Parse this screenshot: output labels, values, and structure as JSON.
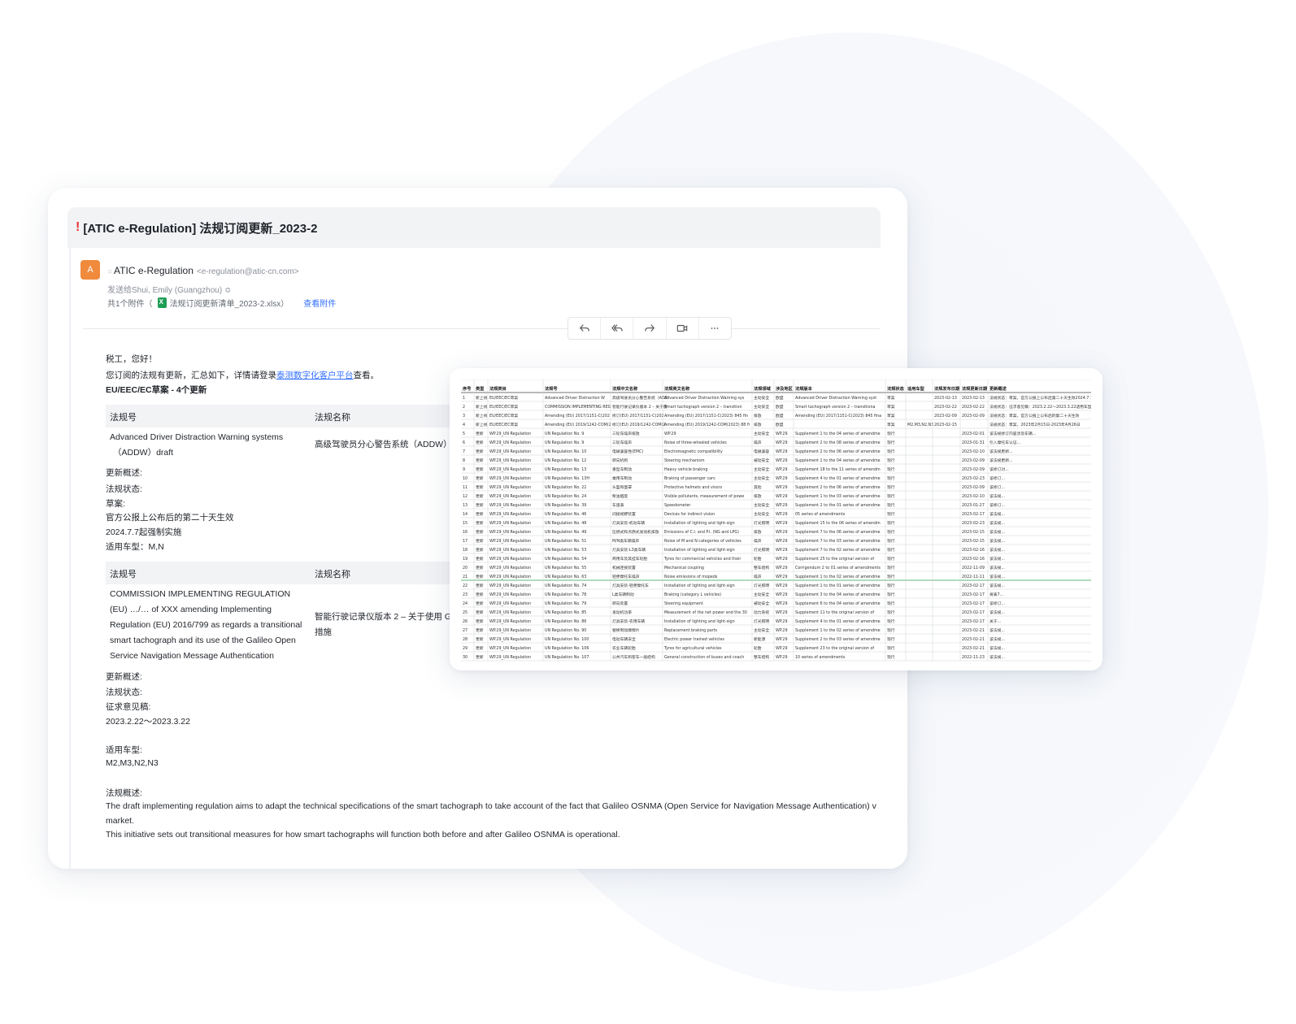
{
  "email": {
    "subject_mark": "!",
    "subject": "[ATIC e-Regulation] 法规订阅更新_2023-2",
    "avatar_letter": "A",
    "sender_name": "ATIC e-Regulation",
    "sender_email": "<e-regulation@atic-cn.com>",
    "to_line": "发送给Shui, Emily (Guangzhou) ≎",
    "attachment_count": "共1个附件（",
    "attachment_name": "法规订阅更新清单_2023-2.xlsx）",
    "view_attachment": "查看附件",
    "actions": [
      {
        "icon": "reply-icon"
      },
      {
        "icon": "reply-all-icon"
      },
      {
        "icon": "forward-icon"
      },
      {
        "icon": "video-icon"
      },
      {
        "icon": "more-icon"
      }
    ]
  },
  "body": {
    "greeting": "税工，您好！",
    "intro_prefix": "您订阅的法规有更新，汇总如下，详情请登录",
    "intro_link": "泰测数字化客户平台",
    "intro_suffix": "查看。",
    "section_title": "EU/EEC/EC草案 - 4个更新",
    "col_no": "法规号",
    "col_name": "法规名称",
    "item1": {
      "number_line1": "Advanced Driver Distraction Warning systems",
      "number_line2": "（ADDW）draft",
      "name": "高级驾驶员分心警告系统（ADDW）",
      "summary_label": "更新概述:",
      "status_label": "法规状态:",
      "status_value": "草案:",
      "line1": "官方公报上公布后的第二十天生效",
      "line2": "2024.7.7起强制实施",
      "vehicle": "适用车型：M,N"
    },
    "item2": {
      "number_lines": [
        "COMMISSION IMPLEMENTING REGULATION",
        "(EU) …/… of XXX amending Implementing",
        "Regulation (EU) 2016/799 as regards a transitional",
        "smart tachograph and its use of the Galileo Open",
        "Service Navigation Message Authentication"
      ],
      "name_line1": "智能行驶记录仪版本 2 – 关于使用 G",
      "name_line2": "措施",
      "summary_label": "更新概述:",
      "status_label": "法规状态:",
      "status_value": "征求意见稿:",
      "period": "2023.2.22～2023.3.22",
      "vehicle_label": "适用车型:",
      "vehicle_value": "M2,M3,N2,N3",
      "overview_label": "法规概述:",
      "overview_line1": "The draft implementing regulation aims to adapt the technical specifications of the smart tachograph to take account of the fact that Galileo OSNMA (Open Service for Navigation Message Authentication) v",
      "overview_line2": "market.",
      "overview_line3": "This initiative sets out transitional measures for how smart tachographs will function both before and after Galileo OSNMA is operational."
    }
  },
  "spreadsheet": {
    "headers": [
      "序号",
      "类型",
      "法规类目",
      "法规号",
      "法规中文名称",
      "法规英文名称",
      "法规领域",
      "涉及地区",
      "法规版本",
      "法规状态",
      "适用车型",
      "法规发布日期",
      "法规更新日期",
      "更新概述"
    ],
    "rows": [
      [
        "1",
        "新上线",
        "EU/EEC/EC草案",
        "Advanced Driver Distraction Warning",
        "高级驾驶员分心警告系统（ADD",
        "Advanced Driver Distraction Warning systems（A",
        "主动安全",
        "欧盟",
        "Advanced Driver Distraction Warning systems（ADD",
        "草案",
        "",
        "2023-02-13",
        "2023-02-13",
        "法规状态：草案，官方公报上公布后第二十天生效2024.7.7"
      ],
      [
        "2",
        "新上线",
        "EU/EEC/EC草案",
        "COMMISSION IMPLEMENTING REG",
        "智能行驶记录仪版本 2 – 关于使",
        "Smart tachograph version 2 – transitional measu",
        "主动安全",
        "欧盟",
        "Smart tachograph version 2 – transitional measu",
        "草案",
        "",
        "2023-02-22",
        "2023-02-22",
        "法规状态：征求意见稿：2023.2.22～2023.3.22适用车型：M"
      ],
      [
        "3",
        "新上线",
        "EU/EEC/EC草案",
        "Amending (EU) 2017/1151-C(2023)",
        "修订(EU) 2017/1151-C(2023)",
        "Amending (EU) 2017/1151-C(2023) 845 final",
        "排放",
        "欧盟",
        "Amending (EU) 2017/1151-C(2023) 845 final",
        "草案",
        "",
        "2023-02-09",
        "2023-02-09",
        "法规状态：草案，官方公报上公布后的第二十天生效"
      ],
      [
        "4",
        "新上线",
        "EU/EEC/EC草案",
        "Amending (EU) 2019/1242-COM(2",
        "修订(EU) 2019/1242-COM(2",
        "Amending (EU) 2019/1242-COM(2023) 88 final",
        "排放",
        "欧盟",
        "",
        "草案",
        "M2,M3,N2,N3",
        "2023-02-15",
        "",
        "法规状态：草案，2023年2月15日-2023年4月26日"
      ],
      [
        "5",
        "更新",
        "WP.29_UN Regulation",
        "UN Regulation No. 9",
        "三轮车噪声排放",
        "WP.29",
        "主动安全",
        "WP.29",
        "Supplement 1 to the 04 series of amendments",
        "现行",
        "",
        "",
        "2023-02-01",
        "该法规修订内容涉及车辆..."
      ],
      [
        "6",
        "更新",
        "WP.29_UN Regulation",
        "UN Regulation No. 9",
        "三轮车噪声",
        "Noise of three-wheeled vehicles",
        "噪声",
        "WP.29",
        "Supplement 2 to the 08 series of amendments",
        "现行",
        "",
        "",
        "2023-01-31",
        "引入摩托车认证..."
      ],
      [
        "7",
        "更新",
        "WP.29_UN Regulation",
        "UN Regulation No. 10",
        "电磁兼容性(EMC)",
        "Electromagnetic compatibility",
        "电磁兼容",
        "WP.29",
        "Supplement 2 to the 06 series of amendments",
        "现行",
        "",
        "",
        "2023-02-10",
        "该法规更新..."
      ],
      [
        "8",
        "更新",
        "WP.29_UN Regulation",
        "UN Regulation No. 12",
        "转向机构",
        "Steering mechanism",
        "被动安全",
        "WP.29",
        "Supplement 1 to the 04 series of amendments",
        "现行",
        "",
        "",
        "2023-02-09",
        "该法规更新..."
      ],
      [
        "9",
        "更新",
        "WP.29_UN Regulation",
        "UN Regulation No. 13",
        "重型车制动",
        "Heavy vehicle braking",
        "主动安全",
        "WP.29",
        "Supplement 18 to the 11 series of amendments",
        "现行",
        "",
        "",
        "2023-02-09",
        "该修订对..."
      ],
      [
        "10",
        "更新",
        "WP.29_UN Regulation",
        "UN Regulation No. 13H",
        "乘用车制动",
        "Braking of passenger cars",
        "主动安全",
        "WP.29",
        "Supplement 4 to the 01 series of amendments",
        "现行",
        "",
        "",
        "2023-02-23",
        "该修订..."
      ],
      [
        "11",
        "更新",
        "WP.29_UN Regulation",
        "UN Regulation No. 22",
        "头盔和面罩",
        "Protective helmets and visors",
        "其他",
        "WP.29",
        "Supplement 2 to the 06 series of amendments",
        "现行",
        "",
        "",
        "2023-02-09",
        "该修订..."
      ],
      [
        "12",
        "更新",
        "WP.29_UN Regulation",
        "UN Regulation No. 24",
        "柴油烟度",
        "Visible pollutants, measurement of power of C.I.",
        "排放",
        "WP.29",
        "Supplement 1 to the 03 series of amendments",
        "现行",
        "",
        "",
        "2023-02-10",
        "该法规..."
      ],
      [
        "13",
        "更新",
        "WP.29_UN Regulation",
        "UN Regulation No. 39",
        "车速表",
        "Speedometer",
        "主动安全",
        "WP.29",
        "Supplement 2 to the 01 series of amendments",
        "现行",
        "",
        "",
        "2023-01-27",
        "该修订..."
      ],
      [
        "14",
        "更新",
        "WP.29_UN Regulation",
        "UN Regulation No. 46",
        "间接视野装置",
        "Devices for indirect vision",
        "主动安全",
        "WP.29",
        "05 series of amendments",
        "现行",
        "",
        "",
        "2023-02-17",
        "该法规..."
      ],
      [
        "15",
        "更新",
        "WP.29_UN Regulation",
        "UN Regulation No. 48",
        "灯具安装-机动车辆",
        "Installation of lighting and light-signalling devices",
        "灯光照明",
        "WP.29",
        "Supplement 15 to the 06 series of amendments",
        "现行",
        "",
        "",
        "2023-02-23",
        "该法规..."
      ],
      [
        "16",
        "更新",
        "WP.29_UN Regulation",
        "UN Regulation No. 49",
        "压燃式和点燃式发动机排放",
        "Emissions of C.I. and P.I. (NG and LPG) engines",
        "排放",
        "WP.29",
        "Supplement 7 to the 06 series of amendments",
        "现行",
        "",
        "",
        "2023-02-15",
        "该法规..."
      ],
      [
        "17",
        "更新",
        "WP.29_UN Regulation",
        "UN Regulation No. 51",
        "M/N类车辆噪声",
        "Noise of M and N categories of vehicles",
        "噪声",
        "WP.29",
        "Supplement 7 to the 03 series of amendments",
        "现行",
        "",
        "",
        "2023-02-15",
        "该法规..."
      ],
      [
        "18",
        "更新",
        "WP.29_UN Regulation",
        "UN Regulation No. 53",
        "灯具安装-L3类车辆",
        "Installation of lighting and light-signalling devices",
        "灯光照明",
        "WP.29",
        "Supplement 7 to the 02 series of amendments",
        "现行",
        "",
        "",
        "2023-02-16",
        "该法规..."
      ],
      [
        "19",
        "更新",
        "WP.29_UN Regulation",
        "UN Regulation No. 54",
        "商用车及其挂车轮胎",
        "Tyres for commercial vehicles and their trailers",
        "轮胎",
        "WP.29",
        "Supplement 25 to the original version of the Reg.",
        "现行",
        "",
        "",
        "2023-02-16",
        "该法规..."
      ],
      [
        "20",
        "更新",
        "WP.29_UN Regulation",
        "UN Regulation No. 55",
        "机械连接装置",
        "Mechanical coupling",
        "整车结构",
        "WP.29",
        "Corrigendum 2 to 01 series of amendments",
        "现行",
        "",
        "",
        "2022-11-09",
        "该法规..."
      ],
      [
        "21",
        "更新",
        "WP.29_UN Regulation",
        "UN Regulation No. 63",
        "轻便摩托车噪声",
        "Noise emissions of mopeds",
        "噪声",
        "WP.29",
        "Supplement 1 to the 02 series of amendments",
        "现行",
        "",
        "",
        "2022-11-11",
        "该法规..."
      ],
      [
        "22",
        "更新",
        "WP.29_UN Regulation",
        "UN Regulation No. 74",
        "灯具安装-轻便摩托车",
        "Installation of lighting and light-signalling devices",
        "灯光照明",
        "WP.29",
        "Supplement 1 to the 01 series of amendments",
        "现行",
        "",
        "",
        "2023-02-17",
        "该法规..."
      ],
      [
        "23",
        "更新",
        "WP.29_UN Regulation",
        "UN Regulation No. 78",
        "L类车辆制动",
        "Braking (category L vehicles)",
        "主动安全",
        "WP.29",
        "Supplement 3 to the 04 series of amendments",
        "现行",
        "",
        "",
        "2023-02-17",
        "将表7..."
      ],
      [
        "24",
        "更新",
        "WP.29_UN Regulation",
        "UN Regulation No. 79",
        "转向装置",
        "Steering equipment",
        "被动安全",
        "WP.29",
        "Supplement 6 to the 04 series of amendments",
        "现行",
        "",
        "",
        "2023-02-17",
        "该修订..."
      ],
      [
        "25",
        "更新",
        "WP.29_UN Regulation",
        "UN Regulation No. 85",
        "发动机功率",
        "Measurement of the net power and the 30 min.",
        "动力系统",
        "WP.29",
        "Supplement 11 to the original version of the Regul.",
        "现行",
        "",
        "",
        "2023-02-17",
        "该法规..."
      ],
      [
        "26",
        "更新",
        "WP.29_UN Regulation",
        "UN Regulation No. 86",
        "灯具安装-农用车辆",
        "Installation of lighting and light-signalling devices",
        "灯光照明",
        "WP.29",
        "Supplement 4 to the 01 series of amendments",
        "现行",
        "",
        "",
        "2023-02-17",
        "关于..."
      ],
      [
        "27",
        "更新",
        "WP.29_UN Regulation",
        "UN Regulation No. 90",
        "替换制动摩擦片",
        "Replacement braking parts",
        "主动安全",
        "WP.29",
        "Supplement 1 to the 02 series of amendments",
        "现行",
        "",
        "",
        "2023-02-21",
        "该法规..."
      ],
      [
        "28",
        "更新",
        "WP.29_UN Regulation",
        "UN Regulation No. 100",
        "电动车辆安全",
        "Electric power trained vehicles",
        "新能源",
        "WP.29",
        "Supplement 2 to the 03 series of amendments",
        "现行",
        "",
        "",
        "2023-02-21",
        "该法规..."
      ],
      [
        "29",
        "更新",
        "WP.29_UN Regulation",
        "UN Regulation No. 106",
        "农业车辆轮胎",
        "Tyres for agricultural vehicles",
        "轮胎",
        "WP.29",
        "Supplement 23 to the original version of the Regul.",
        "现行",
        "",
        "",
        "2023-02-21",
        "该法规..."
      ],
      [
        "30",
        "更新",
        "WP.29_UN Regulation",
        "UN Regulation No. 107",
        "公共汽车和客车一般结构",
        "General construction of buses and coaches",
        "整车结构",
        "WP.29",
        "10 series of amendments",
        "现行",
        "",
        "",
        "2022-11-23",
        "该法规..."
      ]
    ],
    "highlight_row": "21"
  },
  "colors": {
    "accent": "#3370ff",
    "alert": "#e63935",
    "avatar": "#f08a3c",
    "excel": "#1f9d55"
  }
}
